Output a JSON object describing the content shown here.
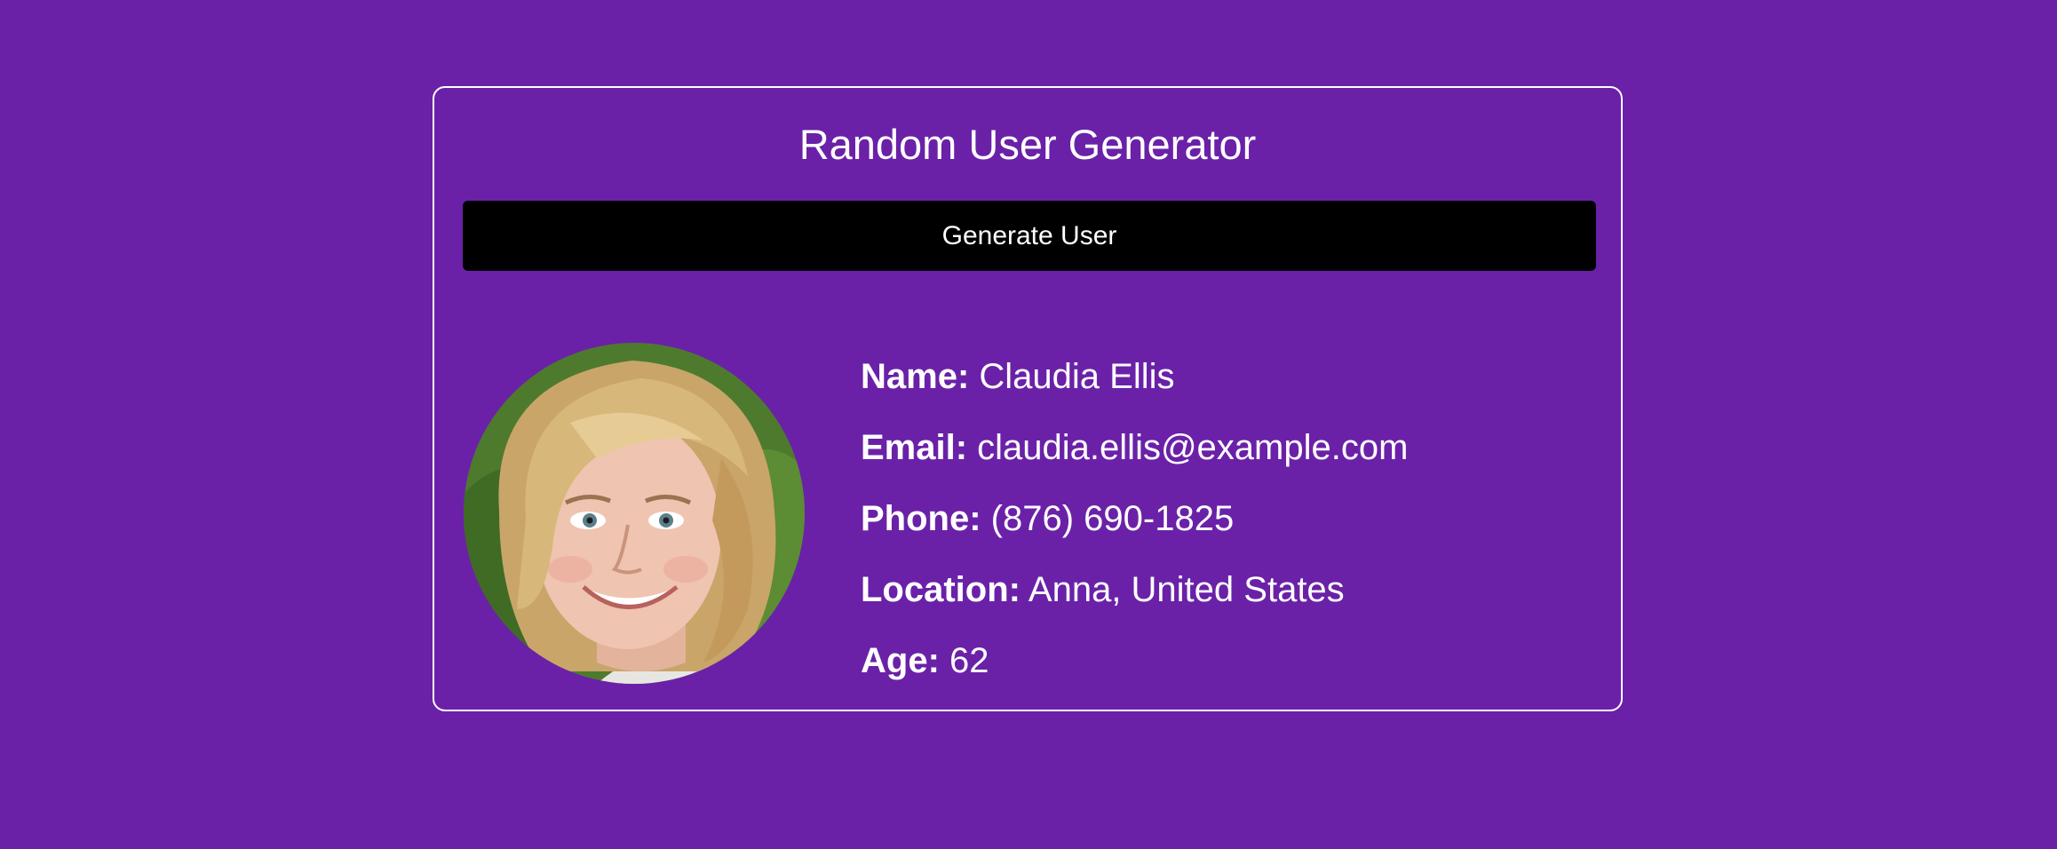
{
  "app": {
    "title": "Random User Generator",
    "generate_button_label": "Generate User"
  },
  "user": {
    "avatar_icon": "user-portrait-photo",
    "fields": [
      {
        "key": "name",
        "label": "Name:",
        "value": "Claudia Ellis"
      },
      {
        "key": "email",
        "label": "Email:",
        "value": "claudia.ellis@example.com"
      },
      {
        "key": "phone",
        "label": "Phone:",
        "value": "(876) 690-1825"
      },
      {
        "key": "location",
        "label": "Location:",
        "value": "Anna, United States"
      },
      {
        "key": "age",
        "label": "Age:",
        "value": "62"
      }
    ]
  },
  "colors": {
    "background": "#6a21a8",
    "card_border": "#ffffff",
    "button_bg": "#000000",
    "text": "#ffffff"
  }
}
